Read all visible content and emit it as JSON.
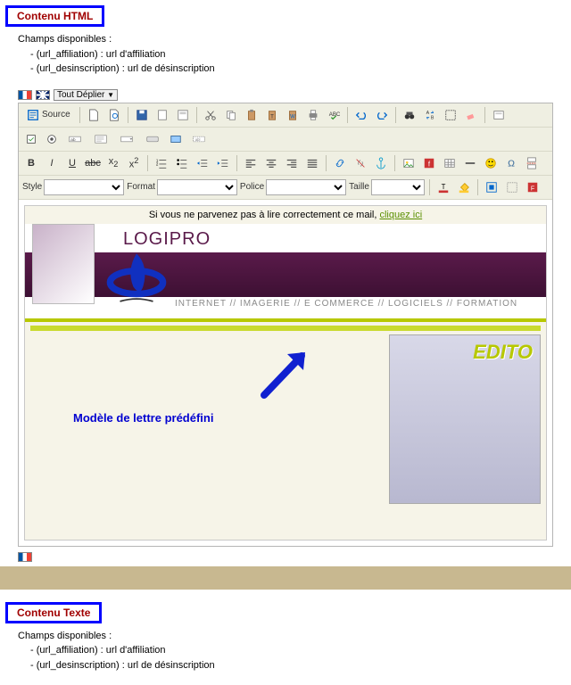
{
  "section_html": {
    "heading": "Contenu HTML",
    "champs_title": "Champs disponibles :",
    "champs": [
      "(url_affiliation) : url d'affiliation",
      "(url_desinscription) : url de désinscription"
    ]
  },
  "flags_row": {
    "tout_deplier": "Tout Déplier"
  },
  "toolbar": {
    "source_label": "Source",
    "style_label": "Style",
    "format_label": "Format",
    "police_label": "Police",
    "taille_label": "Taille",
    "style_options": [
      ""
    ],
    "format_options": [
      ""
    ],
    "police_options": [
      ""
    ],
    "taille_options": [
      ""
    ]
  },
  "mail": {
    "topbar_prefix": "Si vous ne parvenez pas à lire correctement ce mail, ",
    "topbar_link": "cliquez ici",
    "brand": "LOGIPRO",
    "tagline": "INTERNET // IMAGERIE // E COMMERCE // LOGICIELS // FORMATION",
    "edito": "EDITO",
    "annotation": "Modèle de lettre prédéfini"
  },
  "section_text": {
    "heading": "Contenu Texte",
    "champs_title": "Champs disponibles :",
    "champs": [
      "(url_affiliation) : url d'affiliation",
      "(url_desinscription) : url de désinscription"
    ]
  }
}
